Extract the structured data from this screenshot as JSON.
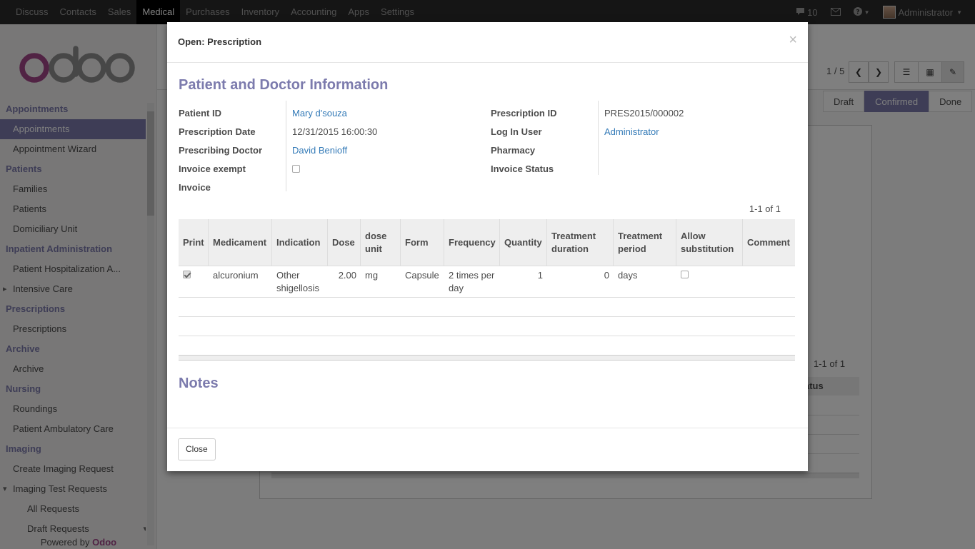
{
  "topbar": {
    "menu": [
      "Discuss",
      "Contacts",
      "Sales",
      "Medical",
      "Purchases",
      "Inventory",
      "Accounting",
      "Apps",
      "Settings"
    ],
    "active": "Medical",
    "messages_count": "10",
    "user": "Administrator"
  },
  "sidebar": {
    "logo": "odoo",
    "items": [
      {
        "type": "sec",
        "label": "Appointments"
      },
      {
        "type": "it",
        "label": "Appointments",
        "active": true
      },
      {
        "type": "it",
        "label": "Appointment Wizard"
      },
      {
        "type": "sec",
        "label": "Patients"
      },
      {
        "type": "it",
        "label": "Families"
      },
      {
        "type": "it",
        "label": "Patients"
      },
      {
        "type": "it",
        "label": "Domiciliary Unit"
      },
      {
        "type": "sec",
        "label": "Inpatient Administration"
      },
      {
        "type": "it",
        "label": "Patient Hospitalization A..."
      },
      {
        "type": "it",
        "label": "Intensive Care",
        "caret": "right"
      },
      {
        "type": "sec",
        "label": "Prescriptions"
      },
      {
        "type": "it",
        "label": "Prescriptions"
      },
      {
        "type": "sec",
        "label": "Archive"
      },
      {
        "type": "it",
        "label": "Archive"
      },
      {
        "type": "sec",
        "label": "Nursing"
      },
      {
        "type": "it",
        "label": "Roundings"
      },
      {
        "type": "it",
        "label": "Patient Ambulatory Care"
      },
      {
        "type": "sec",
        "label": "Imaging"
      },
      {
        "type": "it",
        "label": "Create Imaging Request"
      },
      {
        "type": "it",
        "label": "Imaging Test Requests",
        "caret": "down"
      },
      {
        "type": "sub",
        "label": "All Requests"
      },
      {
        "type": "sub",
        "label": "Draft Requests"
      }
    ],
    "powered_by": "Powered by",
    "powered_brand": "Odoo"
  },
  "background": {
    "pager": "1 / 5",
    "statuses": [
      "Draft",
      "Confirmed",
      "Done"
    ],
    "active_status": "Confirmed",
    "pager2": "1-1 of 1",
    "col_label": "atus"
  },
  "modal": {
    "title": "Open: Prescription",
    "close_symbol": "×",
    "section_title": "Patient and Doctor Information",
    "left_fields": [
      {
        "label": "Patient ID",
        "value": "Mary d'souza",
        "link": true
      },
      {
        "label": "Prescription Date",
        "value": "12/31/2015 16:00:30",
        "link": false
      },
      {
        "label": "Prescribing Doctor",
        "value": "David Benioff",
        "link": true
      },
      {
        "label": "Invoice exempt",
        "value": "",
        "checkbox": true
      },
      {
        "label": "Invoice",
        "value": "",
        "link": false
      }
    ],
    "right_fields": [
      {
        "label": "Prescription ID",
        "value": "PRES2015/000002",
        "link": false
      },
      {
        "label": "Log In User",
        "value": "Administrator",
        "link": true
      },
      {
        "label": "Pharmacy",
        "value": "",
        "link": false
      },
      {
        "label": "Invoice Status",
        "value": "",
        "link": false
      }
    ],
    "table_pager": "1-1 of 1",
    "columns": [
      "Print",
      "Medicament",
      "Indication",
      "Dose",
      "dose unit",
      "Form",
      "Frequency",
      "Quantity",
      "Treatment duration",
      "Treatment period",
      "Allow substitution",
      "Comment"
    ],
    "rows": [
      {
        "print": true,
        "medicament": "alcuronium",
        "indication": "Other shigellosis",
        "dose": "2.00",
        "dose_unit": "mg",
        "form": "Capsule",
        "frequency": "2 times per day",
        "quantity": "1",
        "treatment_duration": "0",
        "treatment_period": "days",
        "allow_substitution": false,
        "comment": ""
      }
    ],
    "notes_title": "Notes",
    "close_button": "Close"
  }
}
